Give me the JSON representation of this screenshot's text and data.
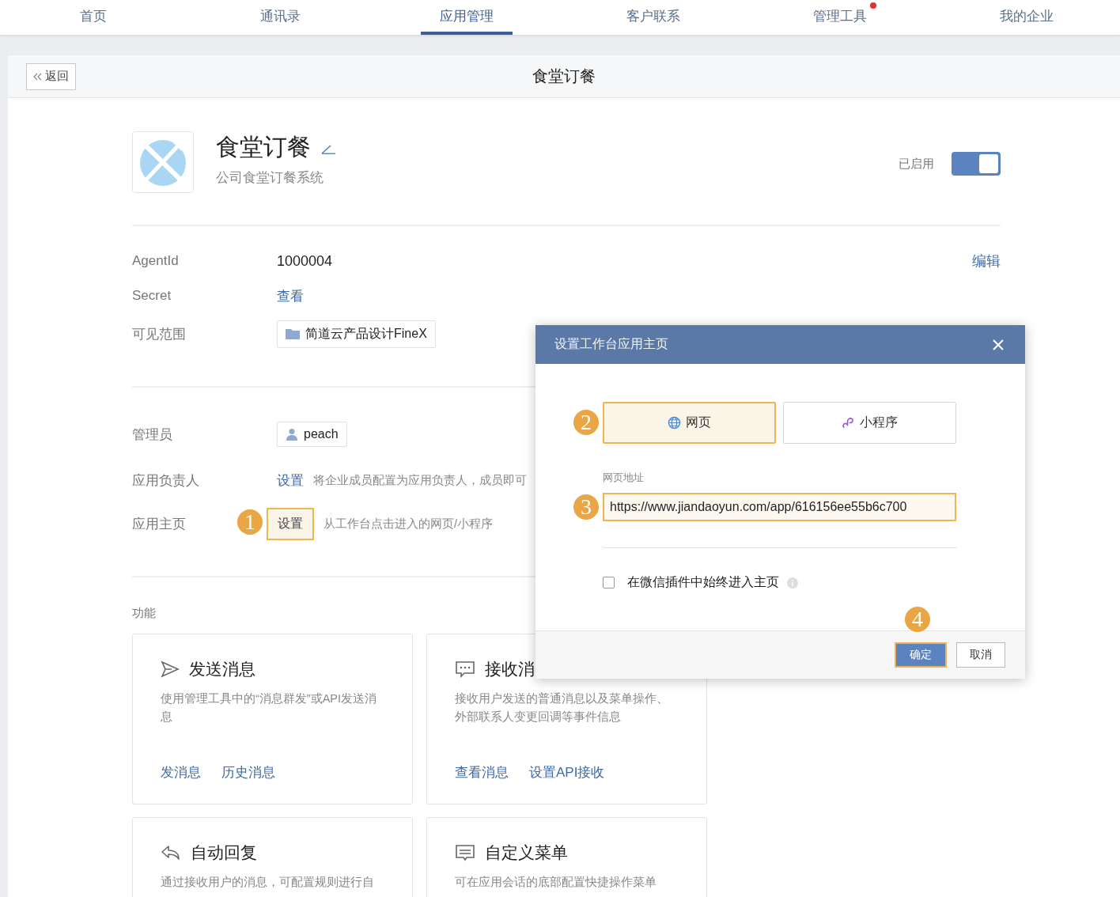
{
  "nav": {
    "tabs": [
      {
        "label": "首页",
        "selected": false,
        "badge": false
      },
      {
        "label": "通讯录",
        "selected": false,
        "badge": false
      },
      {
        "label": "应用管理",
        "selected": true,
        "badge": false
      },
      {
        "label": "客户联系",
        "selected": false,
        "badge": false
      },
      {
        "label": "管理工具",
        "selected": false,
        "badge": true
      },
      {
        "label": "我的企业",
        "selected": false,
        "badge": false
      }
    ]
  },
  "header": {
    "back": "返回",
    "title": "食堂订餐"
  },
  "app": {
    "name": "食堂订餐",
    "description": "公司食堂订餐系统",
    "status": "已启用",
    "enabled": true
  },
  "details": {
    "edit": "编辑",
    "rows": [
      {
        "label": "AgentId",
        "kind": "text",
        "value": "1000004"
      },
      {
        "label": "Secret",
        "kind": "link",
        "value": "查看"
      },
      {
        "label": "可见范围",
        "kind": "dept",
        "value": "简道云产品设计FineX"
      }
    ]
  },
  "roles": {
    "rows": [
      {
        "label": "管理员",
        "kind": "user",
        "value": "peach"
      },
      {
        "label": "应用负责人",
        "kind": "link",
        "value": "设置",
        "hint": "将企业成员配置为应用负责人，成员即可"
      },
      {
        "label": "应用主页",
        "kind": "button",
        "value": "设置",
        "hint": "从工作台点击进入的网页/小程序",
        "step": "1"
      }
    ]
  },
  "features": {
    "title": "功能",
    "cards": [
      {
        "kind": "send",
        "title": "发送消息",
        "description": "使用管理工具中的“消息群发”或API发送消息",
        "links": [
          "发消息",
          "历史消息"
        ]
      },
      {
        "kind": "receive",
        "title": "接收消",
        "description": "接收用户发送的普通消息以及菜单操作、外部联系人变更回调等事件信息",
        "links": [
          "查看消息",
          "设置API接收"
        ]
      },
      {
        "kind": "reply",
        "title": "自动回复",
        "description": "通过接收用户的消息，可配置规则进行自"
      },
      {
        "kind": "menu",
        "title": "自定义菜单",
        "description": "可在应用会话的底部配置快捷操作菜单"
      }
    ]
  },
  "dialog": {
    "title": "设置工作台应用主页",
    "types": [
      {
        "label": "网页",
        "kind": "web",
        "selected": true
      },
      {
        "label": "小程序",
        "kind": "miniprogram",
        "selected": false
      }
    ],
    "type_step": "2",
    "url_label": "网页地址",
    "url": "https://www.jiandaoyun.com/app/616156ee55b6c700",
    "url_step": "3",
    "checkbox": {
      "label": "在微信插件中始终进入主页",
      "checked": false
    },
    "confirm": "确定",
    "confirm_step": "4",
    "cancel": "取消"
  }
}
